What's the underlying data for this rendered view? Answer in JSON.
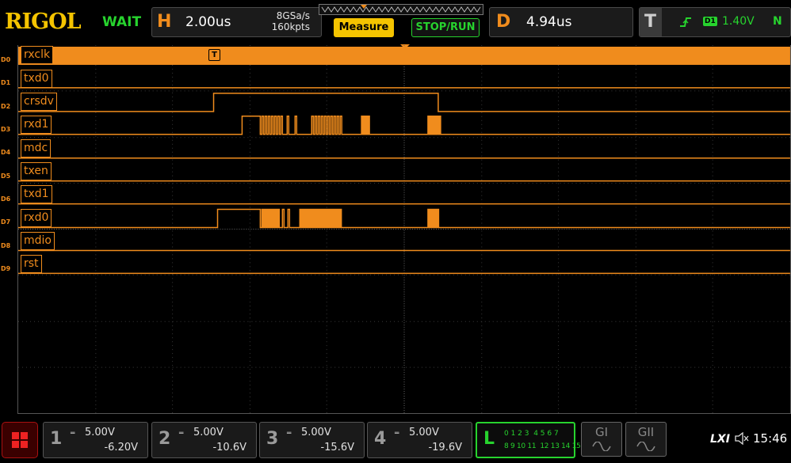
{
  "header": {
    "brand": "RIGOL",
    "run_state": "WAIT",
    "horizontal": {
      "letter": "H",
      "timebase": "2.00us",
      "sample_rate": "8GSa/s",
      "memory_depth": "160kpts"
    },
    "measure_label": "Measure",
    "stop_run_label": "STOP/RUN",
    "delay": {
      "letter": "D",
      "value": "4.94us"
    },
    "trigger": {
      "letter": "T",
      "source": "D1",
      "level": "1.40V",
      "mode": "N"
    }
  },
  "trigger_marker": "T",
  "channels": [
    {
      "tag": "D0",
      "name": "rxclk"
    },
    {
      "tag": "D1",
      "name": "txd0"
    },
    {
      "tag": "D2",
      "name": "crsdv"
    },
    {
      "tag": "D3",
      "name": "rxd1"
    },
    {
      "tag": "D4",
      "name": "mdc"
    },
    {
      "tag": "D5",
      "name": "txen"
    },
    {
      "tag": "D6",
      "name": "txd1"
    },
    {
      "tag": "D7",
      "name": "rxd0"
    },
    {
      "tag": "D8",
      "name": "mdio"
    },
    {
      "tag": "D9",
      "name": "rst"
    }
  ],
  "analog": [
    {
      "num": "1",
      "scale": "5.00V",
      "offset": "-6.20V"
    },
    {
      "num": "2",
      "scale": "5.00V",
      "offset": "-10.6V"
    },
    {
      "num": "3",
      "scale": "5.00V",
      "offset": "-15.6V"
    },
    {
      "num": "4",
      "scale": "5.00V",
      "offset": "-19.6V"
    }
  ],
  "logic": {
    "letter": "L",
    "row1": "0 1 2 3  4 5 6 7",
    "row2": "8 9 10 11  12 13 14 15"
  },
  "generators": {
    "g1": "GI",
    "g2": "GII"
  },
  "status": {
    "lxi": "LXI",
    "time": "15:46"
  },
  "colors": {
    "accent": "#f08c1d",
    "brand": "#f5c400",
    "active": "#27d32e",
    "trace": "#f08c1d"
  }
}
